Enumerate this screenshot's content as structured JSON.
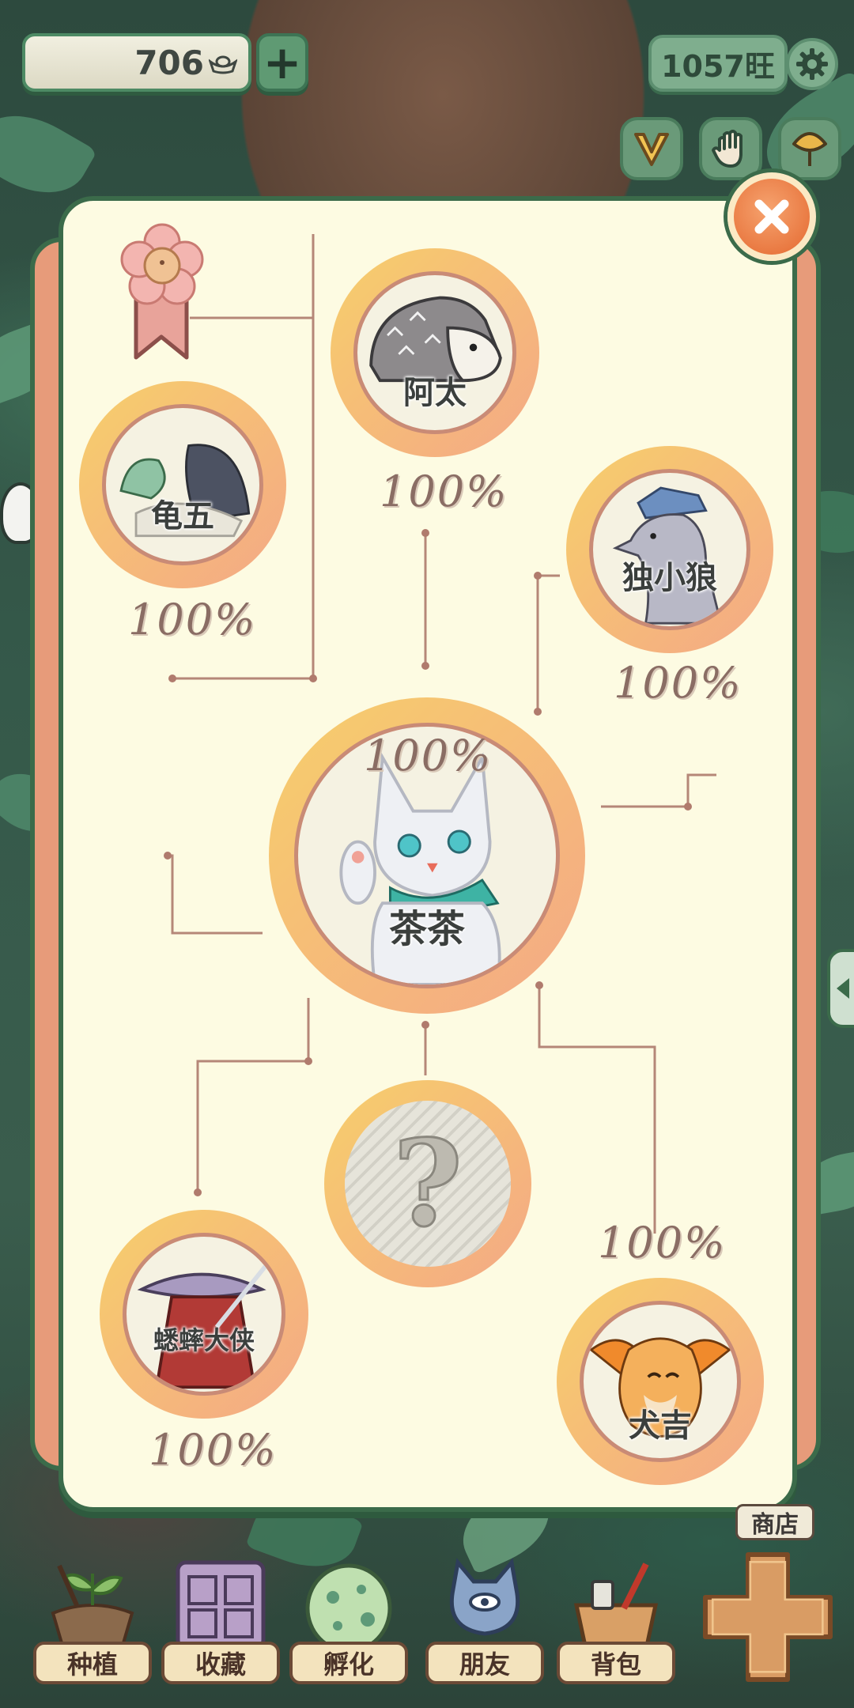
{
  "hud": {
    "coins": "706",
    "wang": "1057旺"
  },
  "characters": [
    {
      "name": "阿太",
      "percent": "100%"
    },
    {
      "name": "龟五",
      "percent": "100%"
    },
    {
      "name": "独小狼",
      "percent": "100%"
    },
    {
      "name": "茶茶",
      "percent": "100%"
    },
    {
      "name": "?",
      "percent": ""
    },
    {
      "name": "蟋蟀大侠",
      "percent": "100%"
    },
    {
      "name": "犬吉",
      "percent": "100%"
    }
  ],
  "shop": {
    "label": "商店"
  },
  "nav": [
    {
      "label": "种植",
      "icon": "plant-pot-icon"
    },
    {
      "label": "收藏",
      "icon": "collection-book-icon"
    },
    {
      "label": "孵化",
      "icon": "egg-icon"
    },
    {
      "label": "朋友",
      "icon": "cat-friend-icon"
    },
    {
      "label": "背包",
      "icon": "basket-icon"
    }
  ],
  "colors": {
    "panel": "#fdfbe2",
    "frame": "#3b6b4a",
    "ring_start": "#f7cf6b",
    "ring_end": "#f4a886",
    "close": "#e4682f"
  }
}
